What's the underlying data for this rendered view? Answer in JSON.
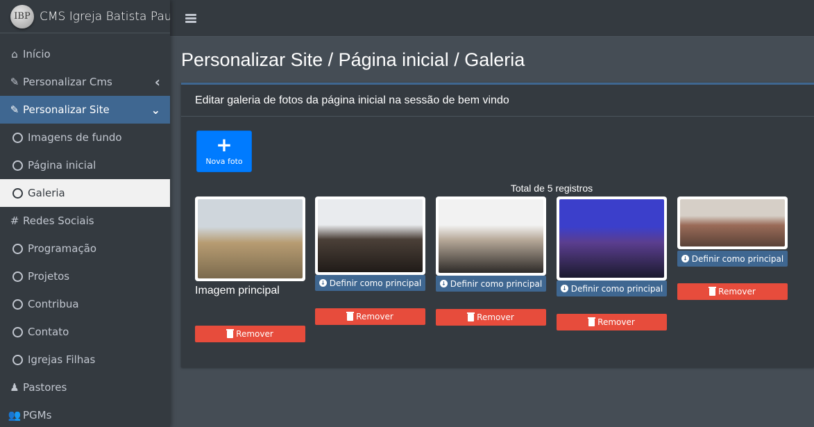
{
  "brand": {
    "logo_text": "IBP",
    "title": "CMS Igreja Batista Pauli"
  },
  "sidebar": {
    "items": [
      {
        "label": "Início",
        "icon": "home-icon",
        "type": "main"
      },
      {
        "label": "Personalizar Cms",
        "icon": "magic-wand-icon",
        "type": "main",
        "arrow": "‹"
      },
      {
        "label": "Personalizar Site",
        "icon": "magic-wand-icon",
        "type": "main-active",
        "arrow": "⌄"
      },
      {
        "label": "Imagens de fundo",
        "icon": "circle-icon",
        "type": "sub"
      },
      {
        "label": "Página inicial",
        "icon": "circle-icon",
        "type": "sub"
      },
      {
        "label": "Galeria",
        "icon": "circle-icon",
        "type": "sub-active"
      },
      {
        "label": "Redes Sociais",
        "icon": "hash-icon",
        "type": "main"
      },
      {
        "label": "Programação",
        "icon": "circle-icon",
        "type": "sub"
      },
      {
        "label": "Projetos",
        "icon": "circle-icon",
        "type": "sub"
      },
      {
        "label": "Contribua",
        "icon": "circle-icon",
        "type": "sub"
      },
      {
        "label": "Contato",
        "icon": "circle-icon",
        "type": "sub"
      },
      {
        "label": "Igrejas Filhas",
        "icon": "circle-icon",
        "type": "sub"
      },
      {
        "label": "Pastores",
        "icon": "user-tie-icon",
        "type": "main"
      },
      {
        "label": "PGMs",
        "icon": "users-icon",
        "type": "main"
      }
    ]
  },
  "page": {
    "title": "Personalizar Site / Página inicial / Galeria",
    "card_title": "Editar galeria de fotos da página inicial na sessão de bem vindo",
    "add_button": "Nova foto",
    "total": "Total de 5 registros"
  },
  "gallery": {
    "main_label": "Imagem principal",
    "define_label": "Definir como principal",
    "remove_label": "Remover",
    "photos": [
      {
        "desc": "group-outdoor",
        "is_main": true,
        "colors": [
          "#cfd6dc",
          "#b79c72",
          "#7b6a4d"
        ]
      },
      {
        "desc": "band-playing",
        "is_main": false,
        "colors": [
          "#e9ebee",
          "#4b4038",
          "#201b18"
        ]
      },
      {
        "desc": "young-people-stage",
        "is_main": false,
        "colors": [
          "#f2f2f2",
          "#b7a999",
          "#2d2a28"
        ]
      },
      {
        "desc": "purple-concert",
        "is_main": false,
        "colors": [
          "#3b3fcb",
          "#5b3e8f",
          "#1b1a2e"
        ]
      },
      {
        "desc": "selfie-group",
        "is_main": false,
        "colors": [
          "#d6cfc7",
          "#9a6b58",
          "#5a4237"
        ]
      }
    ]
  }
}
